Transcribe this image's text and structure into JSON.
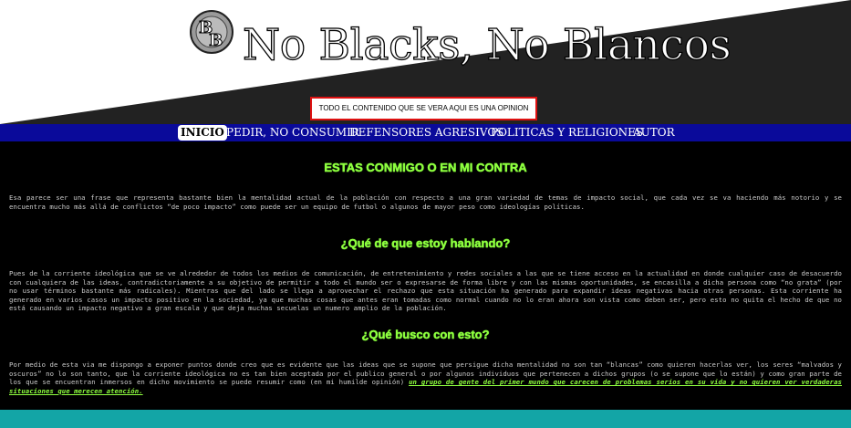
{
  "header": {
    "logo_text": "NB",
    "site_title": "No Blacks, No Blancos",
    "disclaimer": "TODO EL CONTENIDO QUE SE VERA AQUI ES UNA OPINION"
  },
  "nav": {
    "items": [
      {
        "label": "INICIO",
        "active": true
      },
      {
        "label": "PEDIR, NO CONSUMIR",
        "active": false
      },
      {
        "label": "DEFENSORES AGRESIVOS",
        "active": false
      },
      {
        "label": "POLITICAS Y RELIGIONES",
        "active": false
      },
      {
        "label": "AUTOR",
        "active": false
      }
    ]
  },
  "sections": [
    {
      "heading": "ESTAS CONMIGO O EN MI CONTRA",
      "text": "Esa parece ser una frase que representa bastante bien la mentalidad actual de la población con respecto a una gran variedad de temas de impacto social, que cada vez se va haciendo más notorio y se encuentra mucho más allá de conflictos “de poco impacto” como puede ser un equipo de futbol o algunos de mayor peso como ideologías políticas."
    },
    {
      "heading": "¿Qué de que estoy hablando?",
      "text": "Pues de la corriente ideológica que se ve alrededor de todos los medios de comunicación, de entretenimiento y redes sociales a las que se tiene acceso en la actualidad en donde cualquier caso de desacuerdo con cualquiera de las ideas, contradictoriamente a su objetivo de permitir a todo el mundo ser o expresarse de forma libre y con las mismas oportunidades, se encasilla a dicha persona como “no grata” (por no usar términos bastante más radicales). Mientras que del lado se llega a aprovechar el rechazo que esta situación ha generado para expandir ideas negativas hacia otras personas. Esta corriente ha generado en varios casos un impacto positivo en la sociedad, ya que muchas cosas que antes eran tomadas como normal cuando no lo eran ahora son vista como deben ser, pero esto no quita el hecho de que no está causando un impacto negativo a gran escala y que deja muchas secuelas un numero amplio de la población."
    },
    {
      "heading": "¿Qué busco con esto?",
      "text": "Por medio de esta via me dispongo a exponer puntos donde creo que es evidente que las ideas que se supone que persigue dicha mentalidad no son tan “blancas” como quieren hacerlas ver, los seres “malvados y oscuros” no lo son tanto, que la corriente ideológica no es tan bien aceptada por el publico general o por algunos individuos que pertenecen a dichos grupos (o se supone que lo están) y como gran parte de los que se encuentran inmersos en dicho movimiento se puede resumir como (en mi humilde opinión)",
      "link_text": "un grupo de gente del primer mundo que carecen de problemas serios en su vida y no quieren ver verdaderas situaciones que merecen atención."
    }
  ],
  "colors": {
    "accent_green": "#8fff3f",
    "nav_blue": "#0a0a9a",
    "footer_teal": "#13a5a6",
    "disclaimer_border": "#dd1111"
  }
}
